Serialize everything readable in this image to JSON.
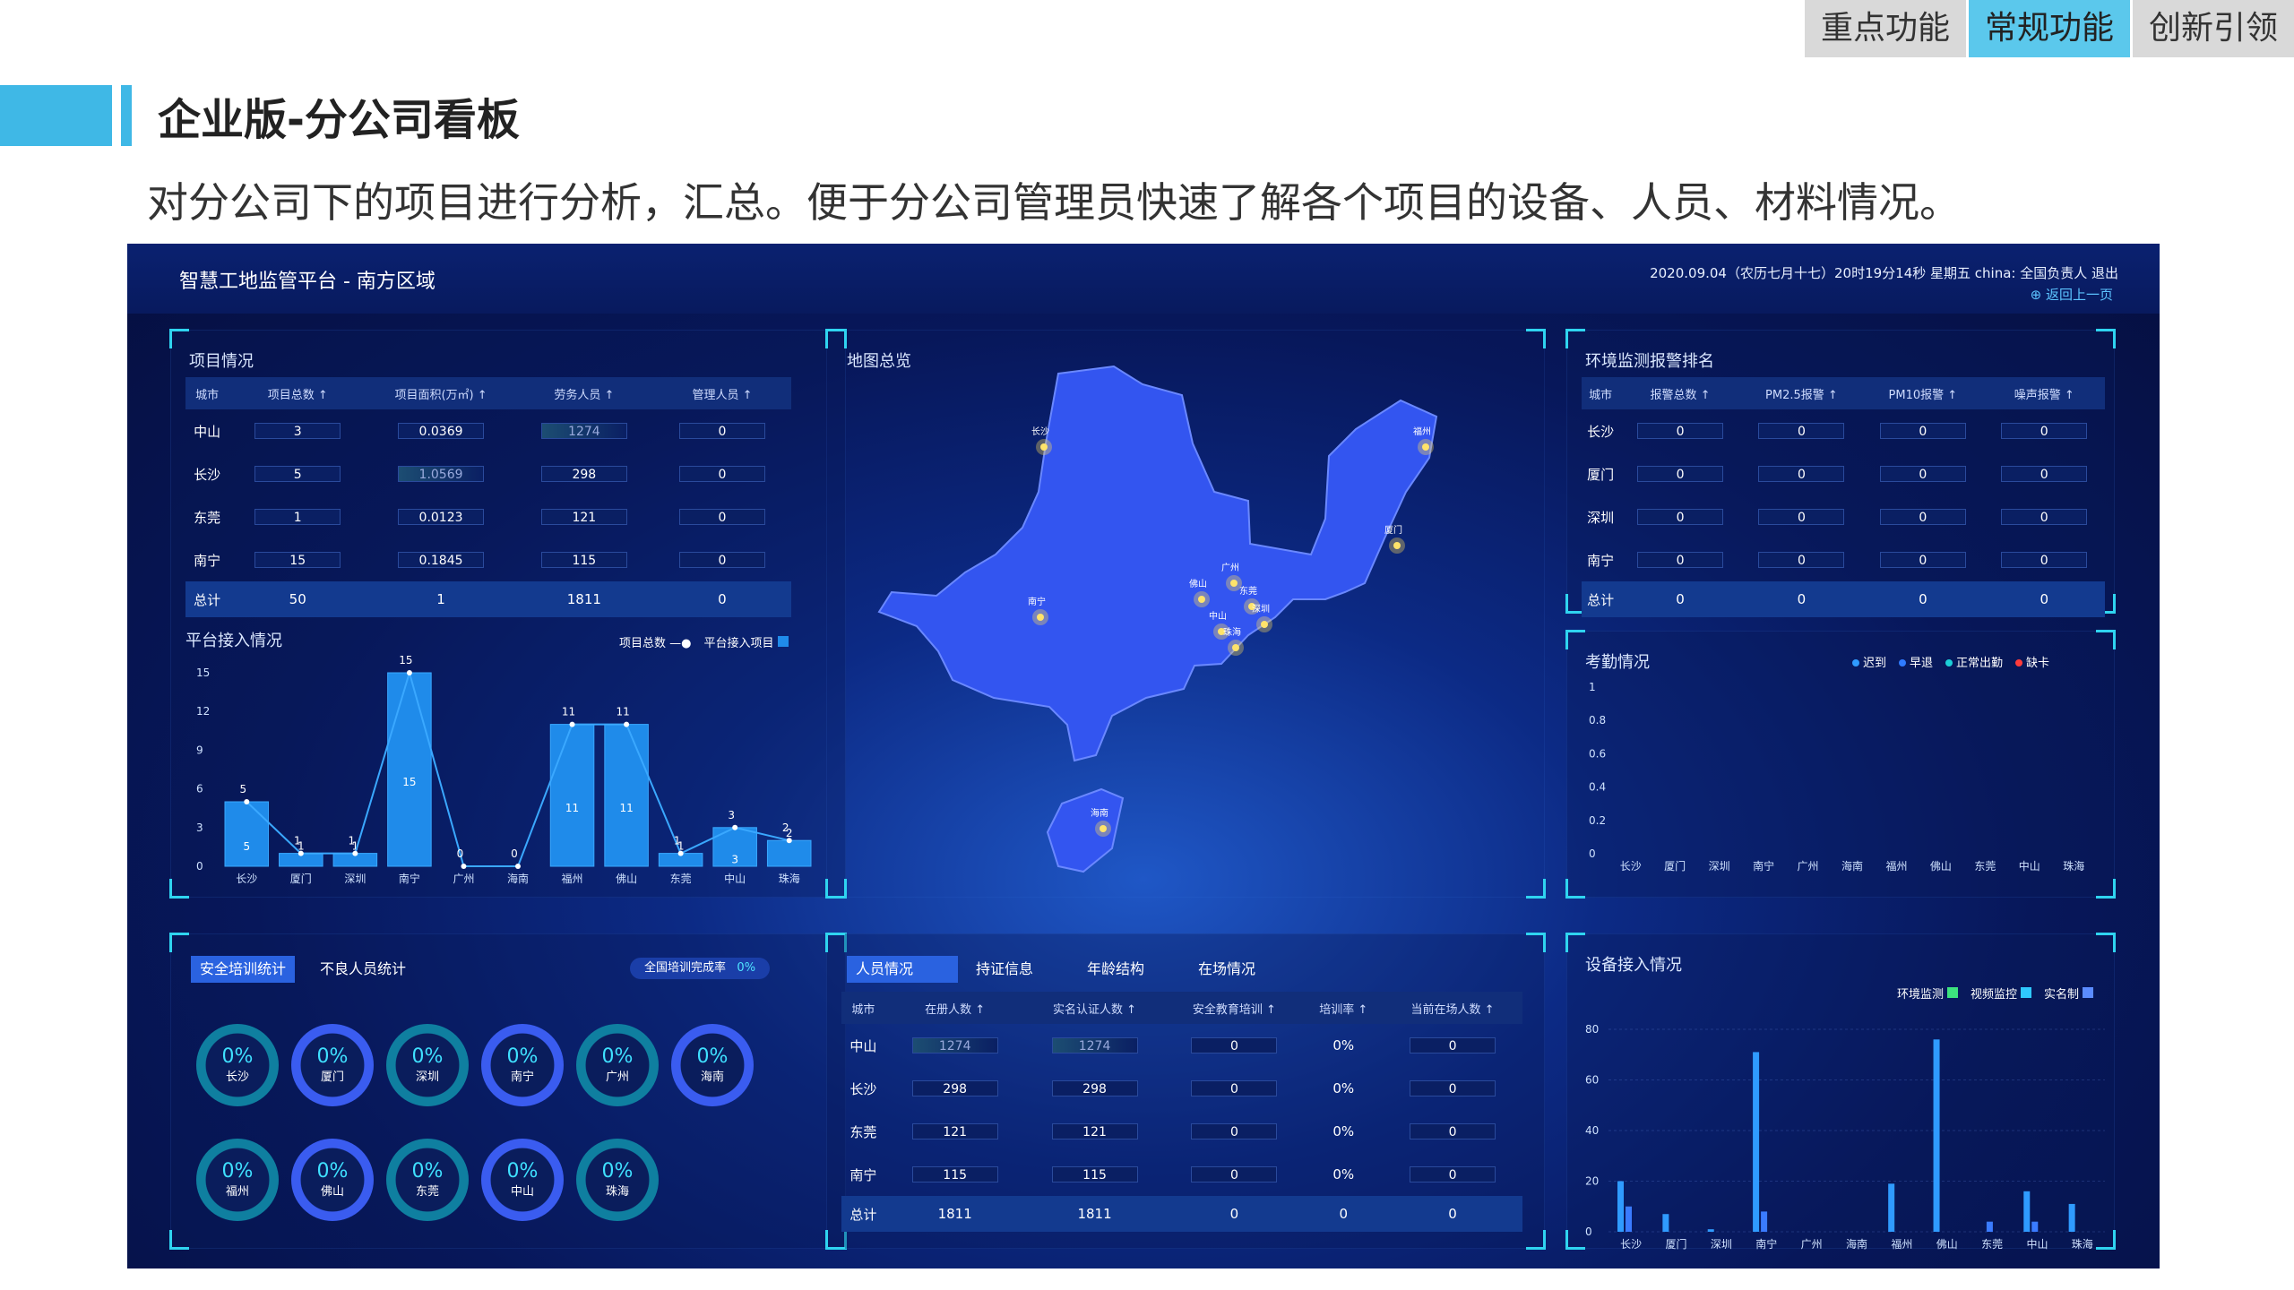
{
  "topnav": [
    "重点功能",
    "常规功能",
    "创新引领"
  ],
  "header": {
    "title": "企业版-分公司看板",
    "subtitle": "对分公司下的项目进行分析，汇总。便于分公司管理员快速了解各个项目的设备、人员、材料情况。"
  },
  "dashboard": {
    "title": "智慧工地监管平台 - 南方区域",
    "info": "2020.09.04（农历七月十七）20时19分14秒 星期五    china: 全国负责人    退出",
    "back": "返回上一页",
    "projects": {
      "title": "项目情况",
      "headers": [
        "城市",
        "项目总数 ↑",
        "项目面积(万㎡) ↑",
        "劳务人员 ↑",
        "管理人员 ↑"
      ],
      "rows": [
        [
          "中山",
          "3",
          "0.0369",
          "1274",
          "0"
        ],
        [
          "长沙",
          "5",
          "1.0569",
          "298",
          "0"
        ],
        [
          "东莞",
          "1",
          "0.0123",
          "121",
          "0"
        ],
        [
          "南宁",
          "15",
          "0.1845",
          "115",
          "0"
        ]
      ],
      "total": [
        "总计",
        "50",
        "1",
        "1811",
        "0"
      ]
    },
    "access": {
      "title": "平台接入情况",
      "legend": [
        "项目总数",
        "平台接入项目"
      ],
      "yticks": [
        "15",
        "12",
        "9",
        "6",
        "3",
        "0"
      ]
    },
    "map": {
      "title": "地图总览",
      "cities": [
        "长沙",
        "福州",
        "厦门",
        "广州",
        "东莞",
        "深圳",
        "佛山",
        "中山",
        "珠海",
        "南宁",
        "海南"
      ]
    },
    "env": {
      "title": "环境监测报警排名",
      "headers": [
        "城市",
        "报警总数 ↑",
        "PM2.5报警 ↑",
        "PM10报警 ↑",
        "噪声报警 ↑"
      ],
      "rows": [
        [
          "长沙",
          "0",
          "0",
          "0",
          "0"
        ],
        [
          "厦门",
          "0",
          "0",
          "0",
          "0"
        ],
        [
          "深圳",
          "0",
          "0",
          "0",
          "0"
        ],
        [
          "南宁",
          "0",
          "0",
          "0",
          "0"
        ]
      ],
      "total": [
        "总计",
        "0",
        "0",
        "0",
        "0"
      ]
    },
    "attendance": {
      "title": "考勤情况",
      "legend": [
        "迟到",
        "早退",
        "正常出勤",
        "缺卡"
      ],
      "yticks": [
        "1",
        "0.8",
        "0.6",
        "0.4",
        "0.2",
        "0"
      ]
    },
    "training": {
      "tabs": [
        "安全培训统计",
        "不良人员统计"
      ],
      "badge_label": "全国培训完成率",
      "badge_value": "0%",
      "donuts": [
        {
          "v": "0%",
          "n": "长沙"
        },
        {
          "v": "0%",
          "n": "厦门"
        },
        {
          "v": "0%",
          "n": "深圳"
        },
        {
          "v": "0%",
          "n": "南宁"
        },
        {
          "v": "0%",
          "n": "广州"
        },
        {
          "v": "0%",
          "n": "海南"
        },
        {
          "v": "0%",
          "n": "福州"
        },
        {
          "v": "0%",
          "n": "佛山"
        },
        {
          "v": "0%",
          "n": "东莞"
        },
        {
          "v": "0%",
          "n": "中山"
        },
        {
          "v": "0%",
          "n": "珠海"
        }
      ]
    },
    "personnel": {
      "tabs": [
        "人员情况",
        "持证信息",
        "年龄结构",
        "在场情况"
      ],
      "headers": [
        "城市",
        "在册人数 ↑",
        "实名认证人数 ↑",
        "安全教育培训 ↑",
        "培训率 ↑",
        "当前在场人数 ↑"
      ],
      "rows": [
        [
          "中山",
          "1274",
          "1274",
          "0",
          "0%",
          "0"
        ],
        [
          "长沙",
          "298",
          "298",
          "0",
          "0%",
          "0"
        ],
        [
          "东莞",
          "121",
          "121",
          "0",
          "0%",
          "0"
        ],
        [
          "南宁",
          "115",
          "115",
          "0",
          "0%",
          "0"
        ]
      ],
      "total": [
        "总计",
        "1811",
        "1811",
        "0",
        "0",
        "0"
      ]
    },
    "devices": {
      "title": "设备接入情况",
      "legend": [
        "环境监测",
        "视频监控",
        "实名制"
      ],
      "yticks": [
        "80",
        "60",
        "40",
        "20",
        "0"
      ]
    }
  },
  "chart_data": [
    {
      "type": "bar",
      "title": "平台接入情况",
      "categories": [
        "长沙",
        "厦门",
        "深圳",
        "南宁",
        "广州",
        "海南",
        "福州",
        "佛山",
        "东莞",
        "中山",
        "珠海"
      ],
      "series": [
        {
          "name": "项目总数",
          "values": [
            5,
            1,
            1,
            15,
            0,
            0,
            11,
            11,
            1,
            3,
            2
          ]
        },
        {
          "name": "平台接入项目",
          "values": [
            5,
            1,
            1,
            15,
            0,
            0,
            11,
            11,
            1,
            3,
            2
          ]
        }
      ],
      "ylim": [
        0,
        15
      ]
    },
    {
      "type": "line",
      "title": "考勤情况",
      "categories": [
        "长沙",
        "厦门",
        "深圳",
        "南宁",
        "广州",
        "海南",
        "福州",
        "佛山",
        "东莞",
        "中山",
        "珠海"
      ],
      "series": [
        {
          "name": "迟到",
          "values": [
            0,
            0,
            0,
            0,
            0,
            0,
            0,
            0,
            0,
            0,
            0
          ]
        },
        {
          "name": "早退",
          "values": [
            0,
            0,
            0,
            0,
            0,
            0,
            0,
            0,
            0,
            0,
            0
          ]
        },
        {
          "name": "正常出勤",
          "values": [
            0,
            0,
            0,
            0,
            0,
            0,
            0,
            0,
            0,
            0,
            0
          ]
        },
        {
          "name": "缺卡",
          "values": [
            0,
            0,
            0,
            0,
            0,
            0,
            0,
            0,
            0,
            0,
            0
          ]
        }
      ],
      "ylim": [
        0,
        1
      ]
    },
    {
      "type": "bar",
      "title": "设备接入情况",
      "categories": [
        "长沙",
        "厦门",
        "深圳",
        "南宁",
        "广州",
        "海南",
        "福州",
        "佛山",
        "东莞",
        "中山",
        "珠海"
      ],
      "series": [
        {
          "name": "环境监测",
          "values": [
            20,
            7,
            1,
            71,
            0,
            0,
            19,
            76,
            0,
            16,
            11
          ]
        },
        {
          "name": "视频监控",
          "values": [
            10,
            0,
            0,
            8,
            0,
            0,
            0,
            0,
            4,
            4,
            0
          ]
        },
        {
          "name": "实名制",
          "values": [
            0,
            0,
            0,
            0,
            0,
            0,
            0,
            0,
            0,
            0,
            0
          ]
        }
      ],
      "ylim": [
        0,
        80
      ]
    }
  ],
  "colors": {
    "accent": "#3fb8e6",
    "dash_bg": "#07175a",
    "panel_corner": "#2fd4f0",
    "bar": "#1f8bea",
    "map": "#3355f0",
    "legend_colors": [
      "#2f9bff",
      "#2f7bff",
      "#1ccfd8",
      "#ff3b3b"
    ],
    "device_colors": [
      "#3de37e",
      "#2fc8ff",
      "#5b8cff"
    ]
  }
}
